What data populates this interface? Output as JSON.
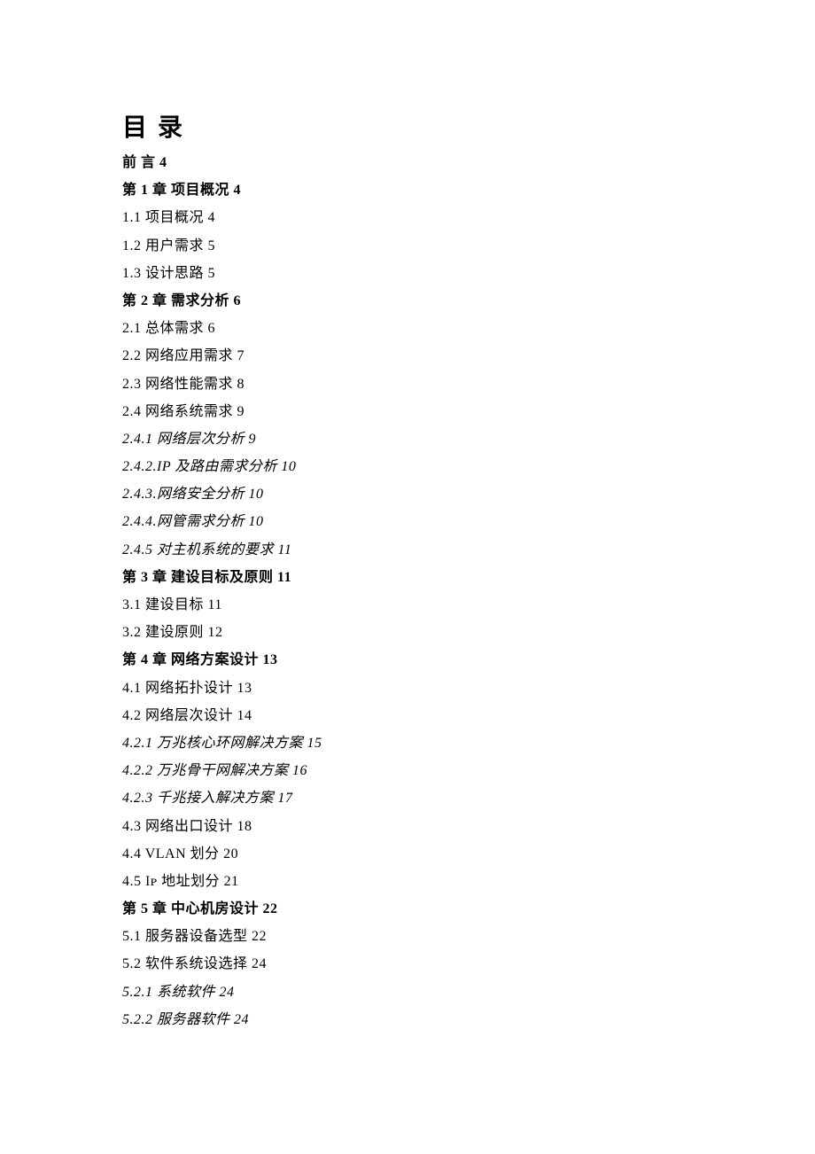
{
  "heading": "目录",
  "toc": [
    {
      "text": "前  言 4",
      "class": "bold"
    },
    {
      "text": "第 1 章  项目概况 4",
      "class": "bold"
    },
    {
      "text": "1.1 项目概况 4",
      "class": ""
    },
    {
      "text": "1.2 用户需求 5",
      "class": ""
    },
    {
      "text": "1.3 设计思路 5",
      "class": ""
    },
    {
      "text": "第 2 章 需求分析 6",
      "class": "bold"
    },
    {
      "text": "2.1 总体需求 6",
      "class": ""
    },
    {
      "text": "2.2 网络应用需求 7",
      "class": ""
    },
    {
      "text": "2.3 网络性能需求 8",
      "class": ""
    },
    {
      "text": "2.4 网络系统需求 9",
      "class": ""
    },
    {
      "text": "2.4.1 网络层次分析 9",
      "class": "italic"
    },
    {
      "text": "2.4.2.IP 及路由需求分析 10",
      "class": "italic"
    },
    {
      "text": "2.4.3.网络安全分析 10",
      "class": "italic"
    },
    {
      "text": "2.4.4.网管需求分析 10",
      "class": "italic"
    },
    {
      "text": "2.4.5 对主机系统的要求 11",
      "class": "italic"
    },
    {
      "text": "第 3 章 建设目标及原则 11",
      "class": "bold"
    },
    {
      "text": "3.1 建设目标 11",
      "class": ""
    },
    {
      "text": "3.2 建设原则 12",
      "class": ""
    },
    {
      "text": "第 4 章 网络方案设计 13",
      "class": "bold"
    },
    {
      "text": "4.1  网络拓扑设计 13",
      "class": ""
    },
    {
      "text": "4.2  网络层次设计 14",
      "class": ""
    },
    {
      "text": "4.2.1 万兆核心环网解决方案 15",
      "class": "italic"
    },
    {
      "text": "4.2.2 万兆骨干网解决方案 16",
      "class": "italic"
    },
    {
      "text": "4.2.3  千兆接入解决方案 17",
      "class": "italic"
    },
    {
      "text": "4.3  网络出口设计 18",
      "class": ""
    },
    {
      "text": "4.4  VLAN 划分 20",
      "class": ""
    },
    {
      "text": "4.5  Iᴘ 地址划分 21",
      "class": ""
    },
    {
      "text": "第 5 章 中心机房设计 22",
      "class": "bold"
    },
    {
      "text": "5.1 服务器设备选型 22",
      "class": ""
    },
    {
      "text": "5.2 软件系统设选择 24",
      "class": ""
    },
    {
      "text": "5.2.1 系统软件 24",
      "class": "italic"
    },
    {
      "text": "5.2.2 服务器软件 24",
      "class": "italic"
    }
  ]
}
